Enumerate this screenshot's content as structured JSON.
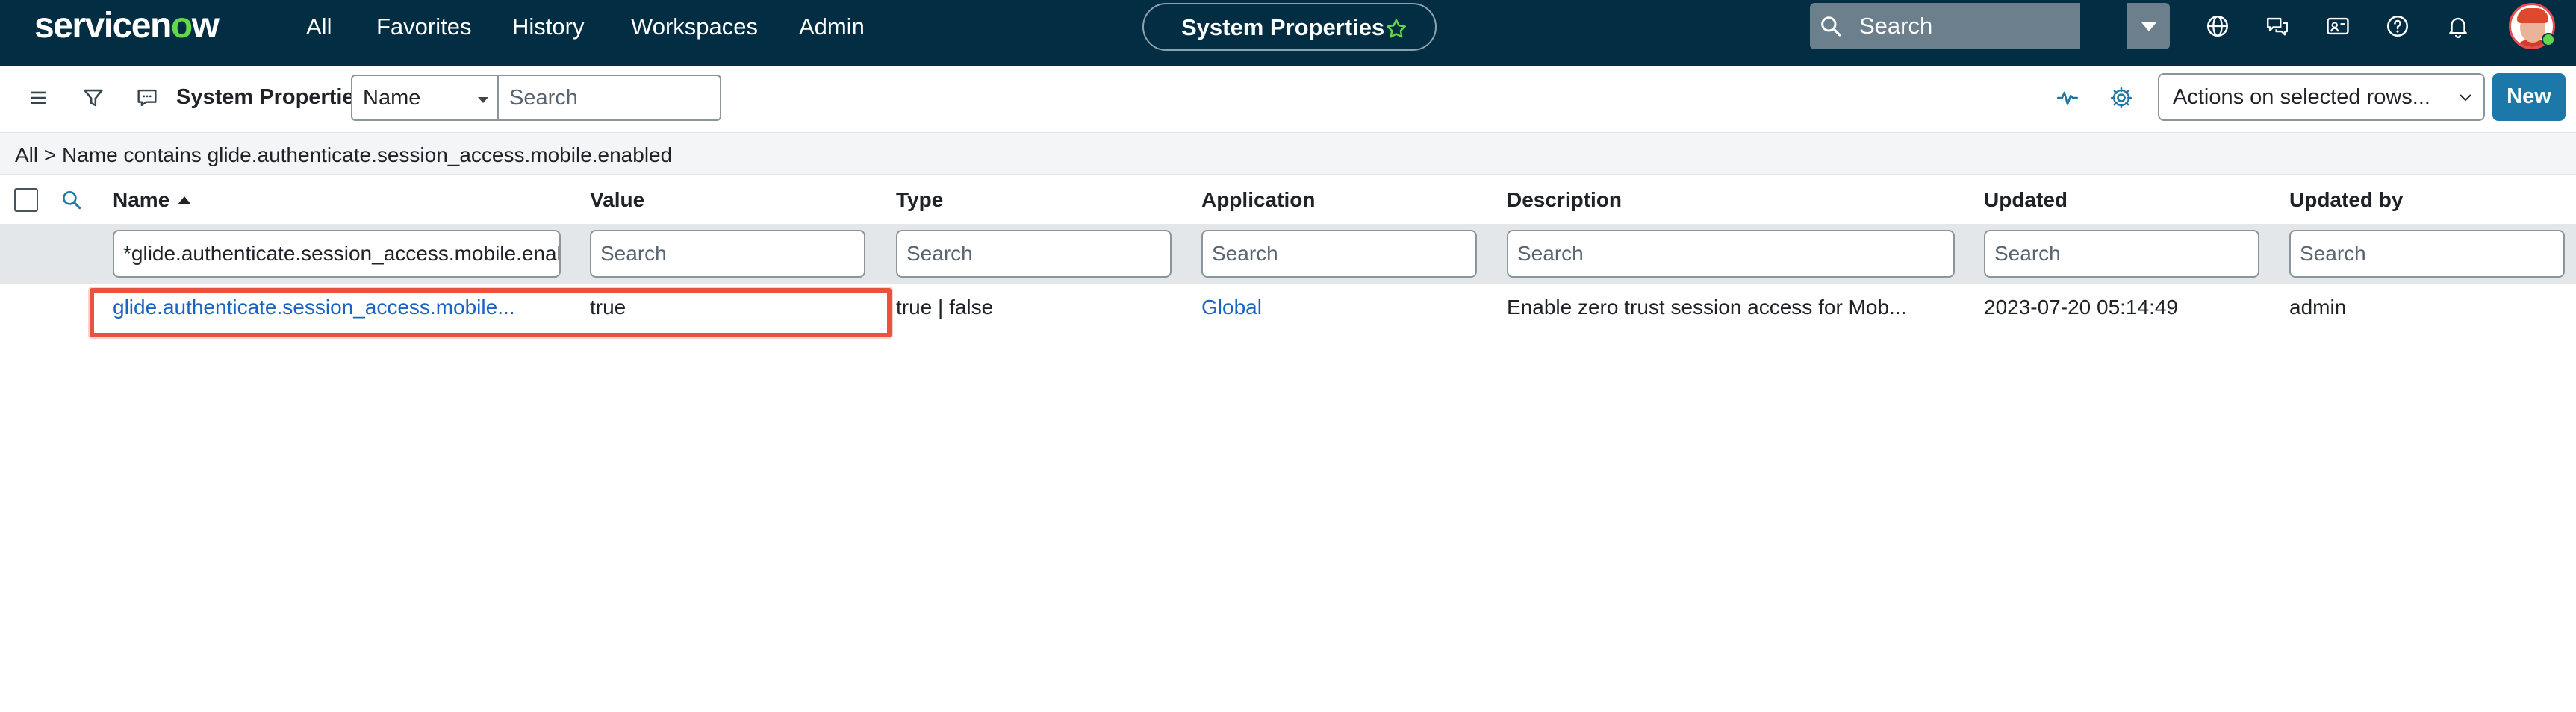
{
  "app": {
    "logo_text_pre": "servicen",
    "logo_text_o": "o",
    "logo_text_post": "w"
  },
  "nav": {
    "items": [
      {
        "label": "All"
      },
      {
        "label": "Favorites"
      },
      {
        "label": "History"
      },
      {
        "label": "Workspaces"
      },
      {
        "label": "Admin"
      }
    ],
    "context_title": "System Properties",
    "global_search_placeholder": "Search"
  },
  "listbar": {
    "title": "System Properties",
    "field_select_value": "Name",
    "search_placeholder": "Search",
    "actions_select_value": "Actions on selected rows...",
    "new_button_label": "New"
  },
  "breadcrumb": {
    "text": "All > Name contains glide.authenticate.session_access.mobile.enabled"
  },
  "table": {
    "columns": [
      {
        "label": "Name",
        "sorted": "ascending"
      },
      {
        "label": "Value"
      },
      {
        "label": "Type"
      },
      {
        "label": "Application"
      },
      {
        "label": "Description"
      },
      {
        "label": "Updated"
      },
      {
        "label": "Updated by"
      }
    ],
    "column_search": {
      "name_value": "*glide.authenticate.session_access.mobile.enabled",
      "placeholder": "Search"
    },
    "rows": [
      {
        "name": "glide.authenticate.session_access.mobile...",
        "value": "true",
        "type": "true | false",
        "application": "Global",
        "description": "Enable zero trust session access for Mob...",
        "updated": "2023-07-20 05:14:49",
        "updated_by": "admin"
      }
    ]
  },
  "colors": {
    "header_bg": "#032d42",
    "accent_green": "#62d84e",
    "primary_button": "#1b78a8",
    "link": "#1a63c2",
    "highlight_border": "#e8523f"
  }
}
